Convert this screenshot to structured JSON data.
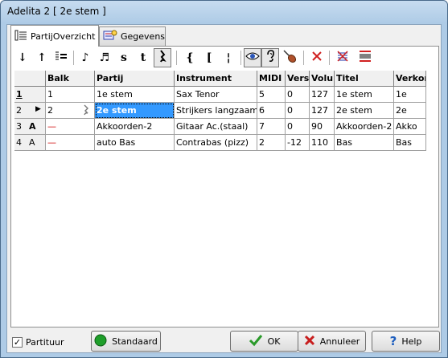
{
  "window": {
    "title": "Adelita  2  [ 2e stem ]"
  },
  "tabs": [
    {
      "label": "PartijOverzicht",
      "icon": "list-icon"
    },
    {
      "label": "Gegevens",
      "icon": "data-icon"
    }
  ],
  "toolbar": {
    "move_down": "↓",
    "move_up": "↑",
    "note8": "♪",
    "note16": "♬",
    "s": "s",
    "t": "t",
    "rest": "𝄽",
    "brace": "{",
    "bracket": "[",
    "barline": "¦"
  },
  "grid": {
    "headers": [
      "",
      "Balk",
      "Partij",
      "Instrument",
      "MIDI",
      "Vers",
      "Volur",
      "Titel",
      "Verkor"
    ],
    "rows": [
      {
        "num": "1",
        "mark": "",
        "balk": "1",
        "partij": "1e stem",
        "instrument": "Sax Tenor",
        "midi": "5",
        "vers": "0",
        "volume": "127",
        "titel": "1e stem",
        "verkort": "1e"
      },
      {
        "num": "2",
        "mark": "▶",
        "balk": "2",
        "partij": "2e stem",
        "instrument": "Strijkers langzaam",
        "midi": "6",
        "vers": "0",
        "volume": "127",
        "titel": "2e stem",
        "verkort": "2e"
      },
      {
        "num": "3",
        "mark": "A",
        "balk": "—",
        "partij": "Akkoorden-2",
        "instrument": "Gitaar Ac.(staal)",
        "midi": "7",
        "vers": "0",
        "volume": "90",
        "titel": "Akkoorden-2",
        "verkort": "Akko"
      },
      {
        "num": "4",
        "mark": "A",
        "balk": "—",
        "partij": "auto Bas",
        "instrument": "Contrabas (pizz)",
        "midi": "2",
        "vers": "-12",
        "volume": "110",
        "titel": "Bas",
        "verkort": "Bas"
      }
    ]
  },
  "footer": {
    "partituur_label": "Partituur",
    "partituur_checked": "✓",
    "standaard_label": "Standaard",
    "ok_label": "OK",
    "annuleer_label": "Annuleer",
    "help_label": "Help"
  },
  "colors": {
    "selection": "#3399ff",
    "titlebar": "#aecbe6",
    "balk_dash": "#cc0000"
  }
}
